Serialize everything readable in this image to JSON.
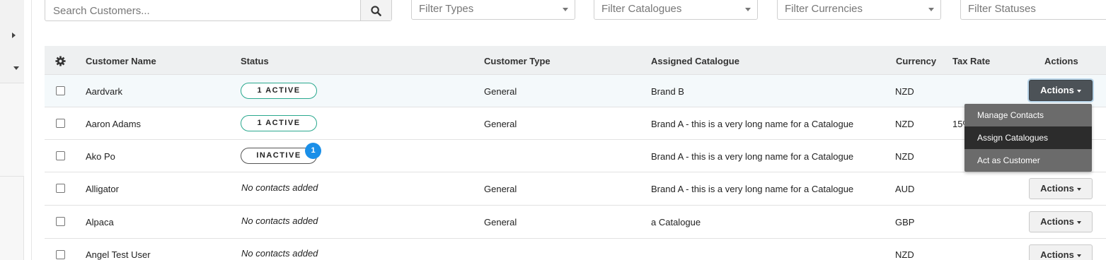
{
  "search": {
    "placeholder": "Search Customers..."
  },
  "filters": [
    {
      "label": "Filter Types"
    },
    {
      "label": "Filter Catalogues"
    },
    {
      "label": "Filter Currencies"
    },
    {
      "label": "Filter Statuses"
    }
  ],
  "table": {
    "columns": {
      "name": "Customer Name",
      "status": "Status",
      "type": "Customer Type",
      "catalogue": "Assigned Catalogue",
      "currency": "Currency",
      "tax": "Tax Rate",
      "actions": "Actions"
    },
    "rows": [
      {
        "name": "Aardvark",
        "status": "1 ACTIVE",
        "type": "General",
        "catalogue": "Brand B",
        "currency": "NZD",
        "tax": "",
        "action": "Actions"
      },
      {
        "name": "Aaron Adams",
        "status": "1 ACTIVE",
        "type": "General",
        "catalogue": "Brand A - this is a very long name for a Catalogue",
        "currency": "NZD",
        "tax": "15%",
        "action": "Actions"
      },
      {
        "name": "Ako Po",
        "status": "INACTIVE",
        "badge": "1",
        "type": "",
        "catalogue": "Brand A - this is a very long name for a Catalogue",
        "currency": "NZD",
        "tax": "",
        "action": "Actions"
      },
      {
        "name": "Alligator",
        "status": "No contacts added",
        "type": "General",
        "catalogue": "Brand A - this is a very long name for a Catalogue",
        "currency": "AUD",
        "tax": "",
        "action": "Actions"
      },
      {
        "name": "Alpaca",
        "status": "No contacts added",
        "type": "General",
        "catalogue": "a Catalogue",
        "currency": "GBP",
        "tax": "",
        "action": "Actions"
      },
      {
        "name": "Angel Test User",
        "status": "No contacts added",
        "type": "",
        "catalogue": "",
        "currency": "NZD",
        "tax": "",
        "action": "Actions"
      }
    ]
  },
  "actions_menu": {
    "items": [
      "Manage Contacts",
      "Assign Catalogues",
      "Act as Customer"
    ],
    "highlighted": "Assign Catalogues"
  },
  "colors": {
    "active_border": "#2aa88e",
    "badge": "#1a8fe8",
    "menu_bg": "#6b6b6b",
    "menu_highlight": "#2c2c2c",
    "header_bg": "#eef0f1"
  },
  "icons": [
    "search-icon",
    "gear-icon",
    "caret-down-icon",
    "expand-arrow-icon",
    "collapse-arrow-icon"
  ]
}
